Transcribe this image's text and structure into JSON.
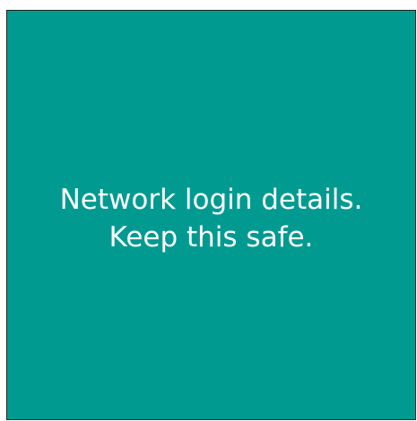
{
  "tile": {
    "background_color": "#009a91",
    "text_color": "#ffffff",
    "lines": [
      "Network login details.",
      "Keep this safe."
    ]
  }
}
